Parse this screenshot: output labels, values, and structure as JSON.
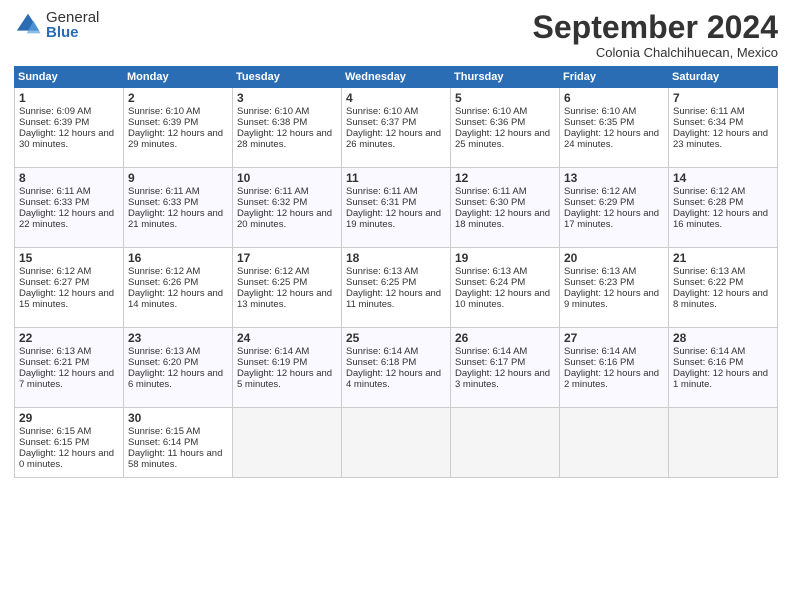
{
  "logo": {
    "general": "General",
    "blue": "Blue"
  },
  "header": {
    "month": "September 2024",
    "location": "Colonia Chalchihuecan, Mexico"
  },
  "days": [
    "Sunday",
    "Monday",
    "Tuesday",
    "Wednesday",
    "Thursday",
    "Friday",
    "Saturday"
  ],
  "weeks": [
    [
      {
        "num": "1",
        "rise": "6:09 AM",
        "set": "6:39 PM",
        "daylight": "12 hours and 30 minutes."
      },
      {
        "num": "2",
        "rise": "6:10 AM",
        "set": "6:39 PM",
        "daylight": "12 hours and 29 minutes."
      },
      {
        "num": "3",
        "rise": "6:10 AM",
        "set": "6:38 PM",
        "daylight": "12 hours and 28 minutes."
      },
      {
        "num": "4",
        "rise": "6:10 AM",
        "set": "6:37 PM",
        "daylight": "12 hours and 26 minutes."
      },
      {
        "num": "5",
        "rise": "6:10 AM",
        "set": "6:36 PM",
        "daylight": "12 hours and 25 minutes."
      },
      {
        "num": "6",
        "rise": "6:10 AM",
        "set": "6:35 PM",
        "daylight": "12 hours and 24 minutes."
      },
      {
        "num": "7",
        "rise": "6:11 AM",
        "set": "6:34 PM",
        "daylight": "12 hours and 23 minutes."
      }
    ],
    [
      {
        "num": "8",
        "rise": "6:11 AM",
        "set": "6:33 PM",
        "daylight": "12 hours and 22 minutes."
      },
      {
        "num": "9",
        "rise": "6:11 AM",
        "set": "6:33 PM",
        "daylight": "12 hours and 21 minutes."
      },
      {
        "num": "10",
        "rise": "6:11 AM",
        "set": "6:32 PM",
        "daylight": "12 hours and 20 minutes."
      },
      {
        "num": "11",
        "rise": "6:11 AM",
        "set": "6:31 PM",
        "daylight": "12 hours and 19 minutes."
      },
      {
        "num": "12",
        "rise": "6:11 AM",
        "set": "6:30 PM",
        "daylight": "12 hours and 18 minutes."
      },
      {
        "num": "13",
        "rise": "6:12 AM",
        "set": "6:29 PM",
        "daylight": "12 hours and 17 minutes."
      },
      {
        "num": "14",
        "rise": "6:12 AM",
        "set": "6:28 PM",
        "daylight": "12 hours and 16 minutes."
      }
    ],
    [
      {
        "num": "15",
        "rise": "6:12 AM",
        "set": "6:27 PM",
        "daylight": "12 hours and 15 minutes."
      },
      {
        "num": "16",
        "rise": "6:12 AM",
        "set": "6:26 PM",
        "daylight": "12 hours and 14 minutes."
      },
      {
        "num": "17",
        "rise": "6:12 AM",
        "set": "6:25 PM",
        "daylight": "12 hours and 13 minutes."
      },
      {
        "num": "18",
        "rise": "6:13 AM",
        "set": "6:25 PM",
        "daylight": "12 hours and 11 minutes."
      },
      {
        "num": "19",
        "rise": "6:13 AM",
        "set": "6:24 PM",
        "daylight": "12 hours and 10 minutes."
      },
      {
        "num": "20",
        "rise": "6:13 AM",
        "set": "6:23 PM",
        "daylight": "12 hours and 9 minutes."
      },
      {
        "num": "21",
        "rise": "6:13 AM",
        "set": "6:22 PM",
        "daylight": "12 hours and 8 minutes."
      }
    ],
    [
      {
        "num": "22",
        "rise": "6:13 AM",
        "set": "6:21 PM",
        "daylight": "12 hours and 7 minutes."
      },
      {
        "num": "23",
        "rise": "6:13 AM",
        "set": "6:20 PM",
        "daylight": "12 hours and 6 minutes."
      },
      {
        "num": "24",
        "rise": "6:14 AM",
        "set": "6:19 PM",
        "daylight": "12 hours and 5 minutes."
      },
      {
        "num": "25",
        "rise": "6:14 AM",
        "set": "6:18 PM",
        "daylight": "12 hours and 4 minutes."
      },
      {
        "num": "26",
        "rise": "6:14 AM",
        "set": "6:17 PM",
        "daylight": "12 hours and 3 minutes."
      },
      {
        "num": "27",
        "rise": "6:14 AM",
        "set": "6:16 PM",
        "daylight": "12 hours and 2 minutes."
      },
      {
        "num": "28",
        "rise": "6:14 AM",
        "set": "6:16 PM",
        "daylight": "12 hours and 1 minute."
      }
    ],
    [
      {
        "num": "29",
        "rise": "6:15 AM",
        "set": "6:15 PM",
        "daylight": "12 hours and 0 minutes."
      },
      {
        "num": "30",
        "rise": "6:15 AM",
        "set": "6:14 PM",
        "daylight": "11 hours and 58 minutes."
      },
      null,
      null,
      null,
      null,
      null
    ]
  ]
}
